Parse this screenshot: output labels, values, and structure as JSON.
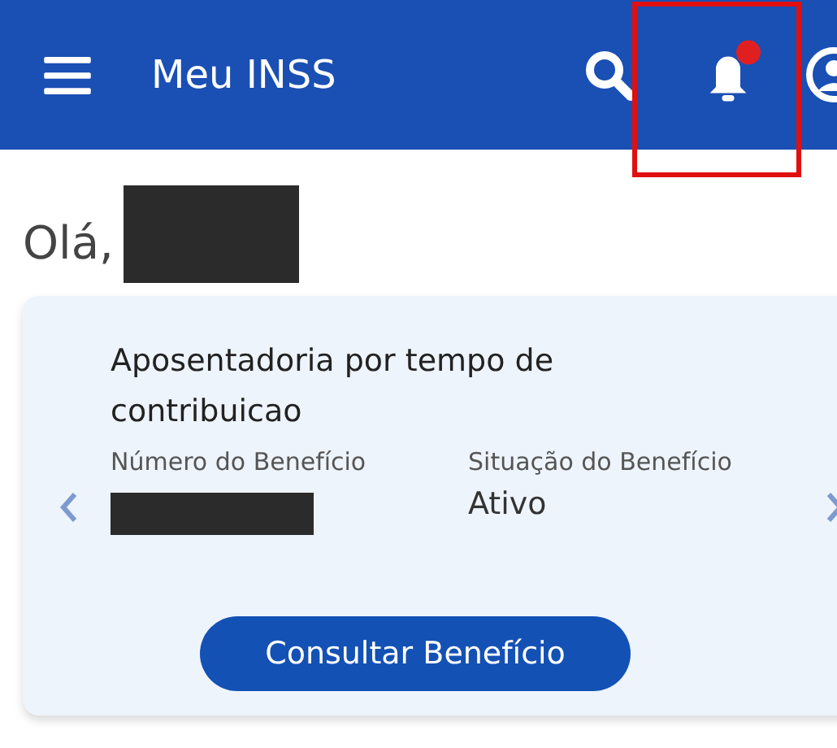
{
  "header": {
    "title": "Meu INSS",
    "notifications": {
      "unread": true,
      "highlighted": true
    }
  },
  "greeting": {
    "text": "Olá,",
    "name_redacted": true
  },
  "benefit_card": {
    "title": "Aposentadoria por tempo de contribuicao",
    "fields": [
      {
        "label": "Número do Benefício",
        "value_redacted": true
      },
      {
        "label": "Situação do Benefício",
        "value": "Ativo"
      }
    ],
    "button": "Consultar Benefício"
  }
}
